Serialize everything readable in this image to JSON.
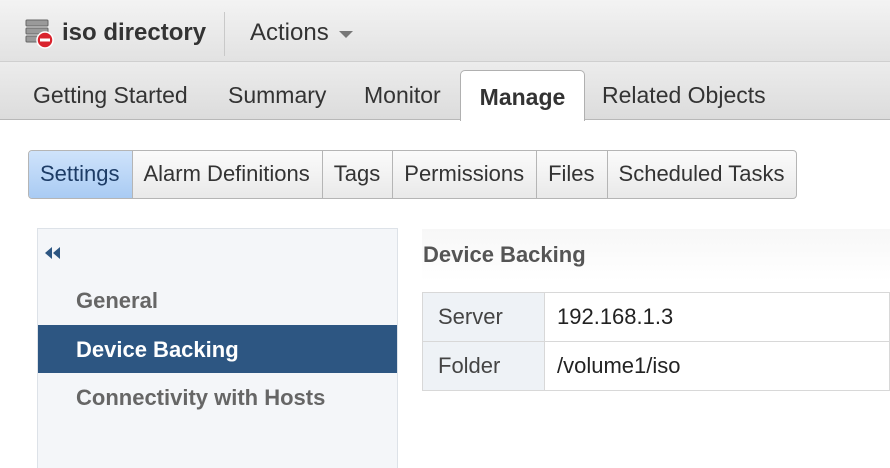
{
  "header": {
    "title": "iso directory",
    "icon": "datastore-error-icon",
    "actions_label": "Actions"
  },
  "main_tabs": [
    {
      "label": "Getting Started"
    },
    {
      "label": "Summary"
    },
    {
      "label": "Monitor"
    },
    {
      "label": "Manage",
      "active": true
    },
    {
      "label": "Related Objects"
    }
  ],
  "sub_tabs": [
    {
      "label": "Settings",
      "active": true
    },
    {
      "label": "Alarm Definitions"
    },
    {
      "label": "Tags"
    },
    {
      "label": "Permissions"
    },
    {
      "label": "Files"
    },
    {
      "label": "Scheduled Tasks"
    }
  ],
  "sidebar": {
    "collapse_icon": "double-chevron-left-icon",
    "items": [
      {
        "label": "General"
      },
      {
        "label": "Device Backing",
        "selected": true
      },
      {
        "label": "Connectivity with Hosts"
      }
    ]
  },
  "detail": {
    "title": "Device Backing",
    "rows": [
      {
        "key": "Server",
        "value": "192.168.1.3"
      },
      {
        "key": "Folder",
        "value": "/volume1/iso"
      }
    ]
  },
  "colors": {
    "accent": "#2d5682",
    "subtab_active": "#bcd7f7",
    "error_badge": "#d9232d"
  }
}
